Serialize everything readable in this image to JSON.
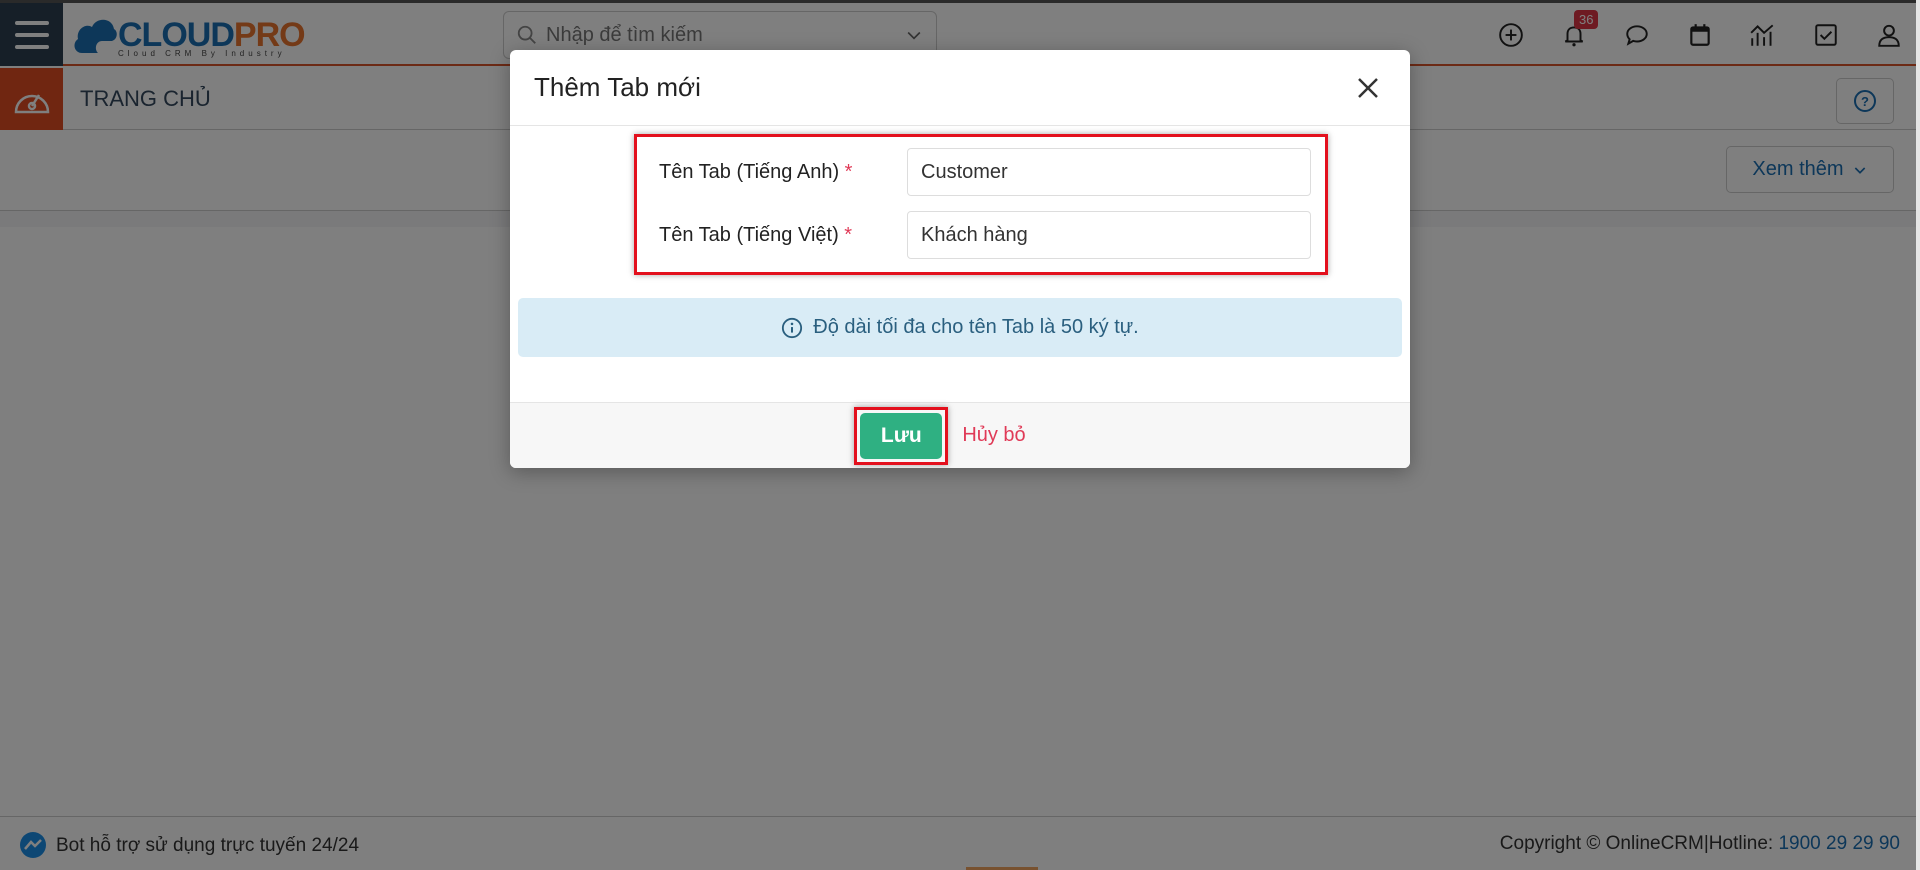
{
  "app": {
    "logo_main": "CLOUD",
    "logo_accent": "PRO",
    "logo_tagline": "Cloud CRM By Industry"
  },
  "topbar": {
    "search_placeholder": "Nhập để tìm kiếm",
    "notification_count": "36",
    "icons": [
      "plus-circle-icon",
      "bell-icon",
      "chat-icon",
      "calendar-icon",
      "report-icon",
      "task-icon",
      "user-icon"
    ]
  },
  "header": {
    "page_title": "TRANG CHỦ"
  },
  "toolbar": {
    "more_label": "Xem thêm"
  },
  "modal": {
    "title": "Thêm Tab mới",
    "fields": [
      {
        "label": "Tên Tab (Tiếng Anh)",
        "required_mark": "*",
        "value": "Customer"
      },
      {
        "label": "Tên Tab (Tiếng Việt)",
        "required_mark": "*",
        "value": "Khách hàng"
      }
    ],
    "info_text": "Độ dài tối đa cho tên Tab là 50 ký tự.",
    "save_label": "Lưu",
    "cancel_label": "Hủy bỏ"
  },
  "footer": {
    "bot_text": "Bot hỗ trợ sử dụng trực tuyến 24/24",
    "copyright": "Copyright © OnlineCRM|Hotline: ",
    "hotline": "1900 29 29 90"
  },
  "colors": {
    "brand_blue": "#1b6fb3",
    "brand_orange": "#e14d22",
    "save_green": "#2fb082",
    "cancel_red": "#e03a57",
    "highlight_red": "#e3101d"
  }
}
